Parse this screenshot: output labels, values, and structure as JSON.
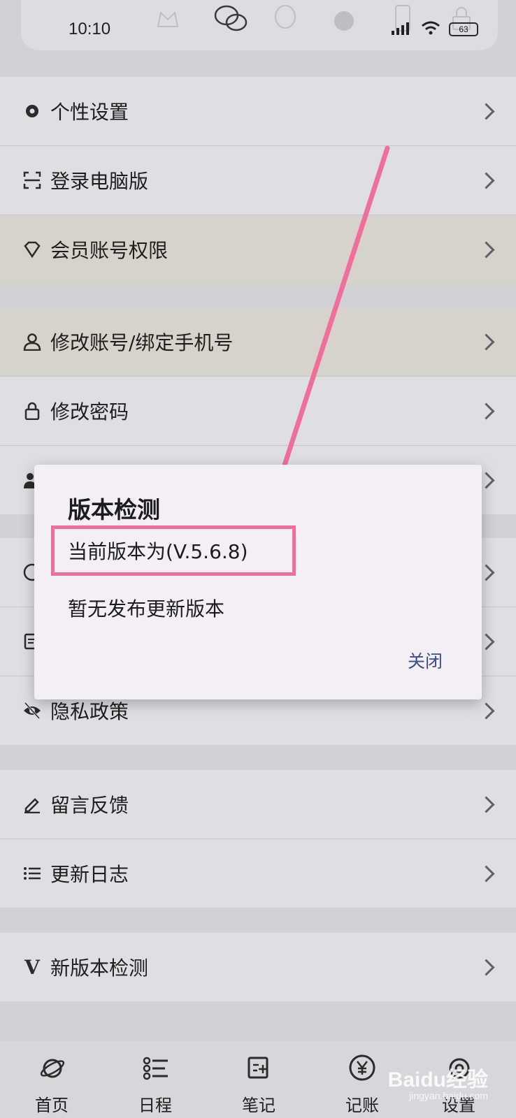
{
  "status_bar": {
    "time": "10:10",
    "battery": "63"
  },
  "settings_groups": [
    {
      "items": [
        {
          "label": "个性设置",
          "icon": "gear-icon"
        },
        {
          "label": "登录电脑版",
          "icon": "scan-icon"
        },
        {
          "label": "会员账号权限",
          "icon": "diamond-icon"
        }
      ]
    },
    {
      "items": [
        {
          "label": "修改账号/绑定手机号",
          "icon": "user-icon"
        },
        {
          "label": "修改密码",
          "icon": "lock-icon"
        }
      ]
    },
    {
      "items": [
        {
          "label": "隐私政策",
          "icon": "eye-off-icon"
        }
      ]
    },
    {
      "items": [
        {
          "label": "留言反馈",
          "icon": "pencil-icon"
        },
        {
          "label": "更新日志",
          "icon": "list-icon"
        }
      ]
    },
    {
      "items": [
        {
          "label": "新版本检测",
          "icon": "v-icon"
        }
      ]
    }
  ],
  "dialog": {
    "title": "版本检测",
    "current_version": "当前版本为(V.5.6.8)",
    "message": "暂无发布更新版本",
    "close_label": "关闭"
  },
  "tabs": [
    {
      "label": "首页",
      "icon": "planet-icon"
    },
    {
      "label": "日程",
      "icon": "schedule-icon"
    },
    {
      "label": "笔记",
      "icon": "note-icon"
    },
    {
      "label": "记账",
      "icon": "yen-icon"
    },
    {
      "label": "设置",
      "icon": "settings-icon"
    }
  ],
  "watermark": {
    "brand": "Baidu经验",
    "url": "jingyan.baidu.com"
  },
  "colors": {
    "dialog_bg": "#f3eff5",
    "accent_button": "#3b4f8a",
    "highlight": "#ee6f9e",
    "arrow": "#ee6f9e"
  }
}
